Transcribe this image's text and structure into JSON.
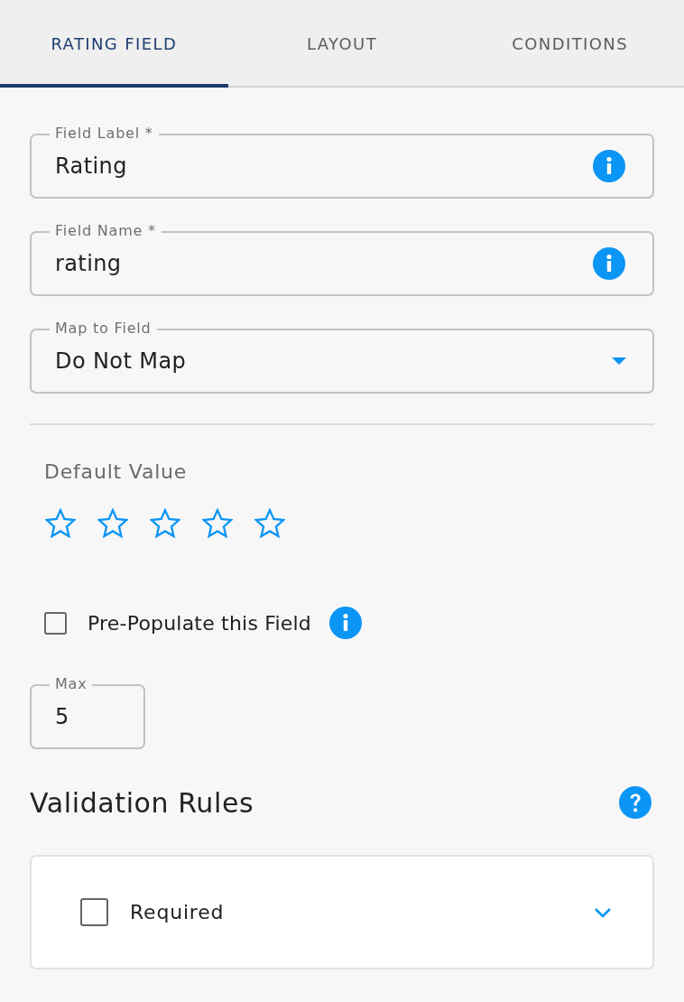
{
  "tabs": [
    {
      "label": "RATING FIELD",
      "selected": true
    },
    {
      "label": "LAYOUT",
      "selected": false
    },
    {
      "label": "CONDITIONS",
      "selected": false
    }
  ],
  "fields": [
    {
      "kind": "text",
      "label": "Field Label *",
      "value": "Rating"
    },
    {
      "kind": "text",
      "label": "Field Name *",
      "value": "rating"
    },
    {
      "kind": "select",
      "label": "Map to Field",
      "value": "Do Not Map"
    }
  ],
  "default_value": {
    "label": "Default Value",
    "stars": 0
  },
  "prepopulate": {
    "label": "Pre-Populate this Field",
    "checked": false
  },
  "max_field": {
    "label": "Max",
    "value": "5"
  },
  "validation": {
    "title": "Validation Rules",
    "rules": [
      {
        "label": "Required",
        "checked": false,
        "expanded": false
      }
    ]
  }
}
